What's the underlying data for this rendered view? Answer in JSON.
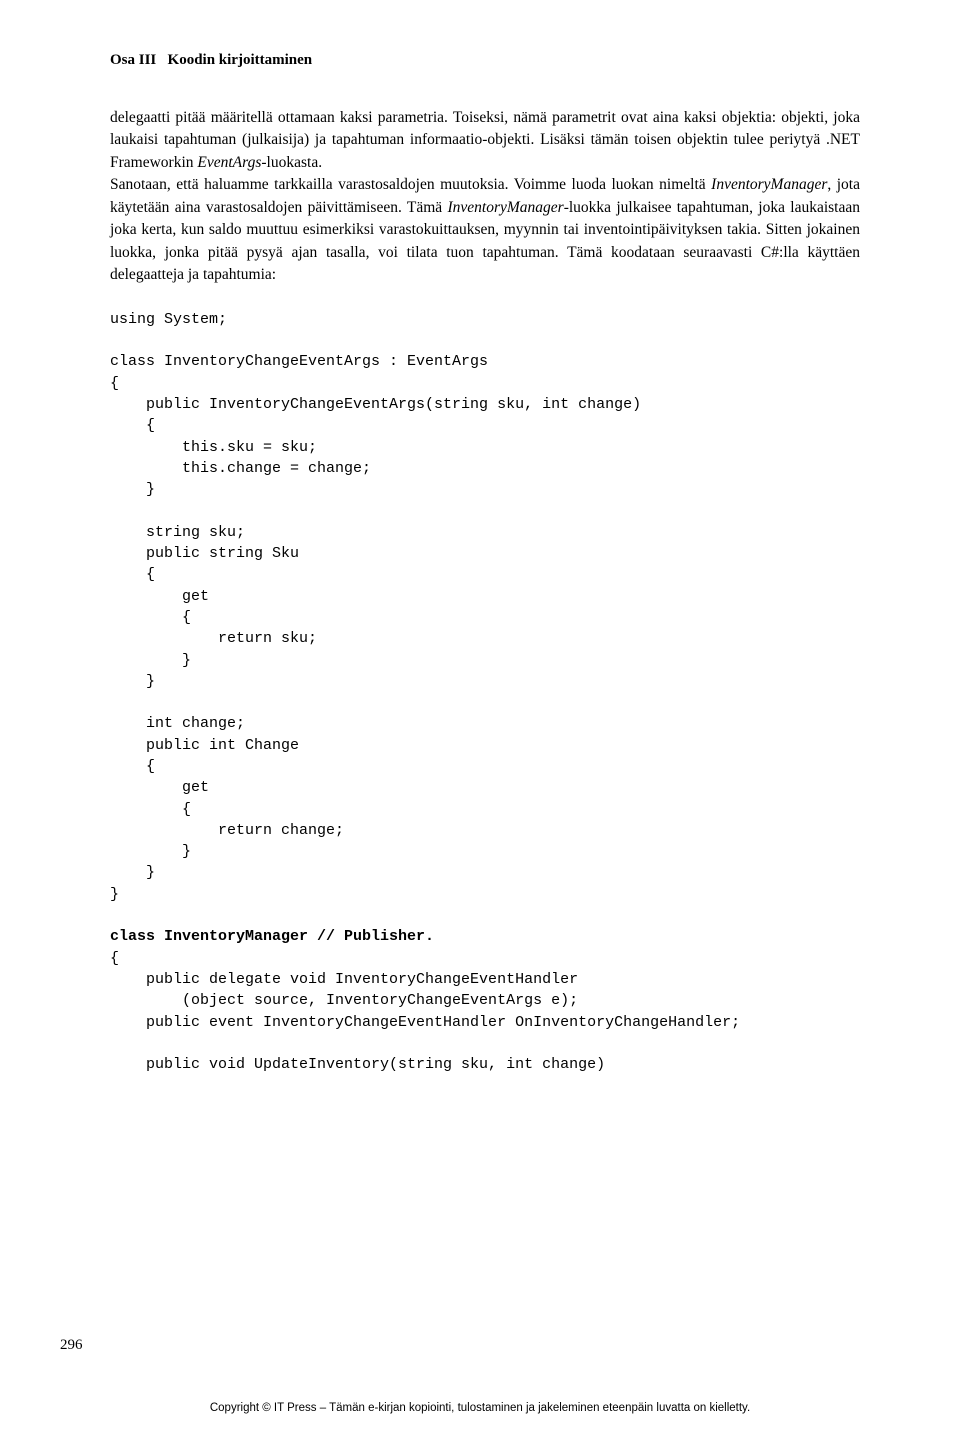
{
  "header": {
    "part": "Osa III",
    "title": "Koodin kirjoittaminen"
  },
  "paragraph1": "delegaatti pitää määritellä ottamaan kaksi parametria. Toiseksi, nämä parametrit ovat aina kaksi objektia: objekti, joka laukaisi tapahtuman (julkaisija) ja tapahtuman informaatio-objekti. Lisäksi tämän toisen objektin tulee periytyä .NET Frameworkin ",
  "paragraph1_italic1": "EventArgs",
  "paragraph1_cont": "-luokasta.",
  "paragraph2": "Sanotaan, että haluamme tarkkailla varastosaldojen muutoksia. Voimme luoda luokan nimeltä ",
  "paragraph2_italic1": "InventoryManager",
  "paragraph2_cont1": ", jota käytetään aina varastosaldojen päivittämiseen. Tämä ",
  "paragraph2_italic2": "InventoryManager",
  "paragraph2_cont2": "-luokka julkaisee tapahtuman, joka laukaistaan joka kerta, kun saldo muuttuu esimerkiksi varastokuittauksen, myynnin tai inventointipäivityksen takia. Sitten jokainen luokka, jonka pitää pysyä ajan tasalla, voi tilata tuon tapahtuman. Tämä koodataan seuraavasti C#:lla käyttäen delegaatteja ja tapahtumia:",
  "code": {
    "line1": "using System;",
    "line2": "class InventoryChangeEventArgs : EventArgs",
    "line3": "{",
    "line4": "    public InventoryChangeEventArgs(string sku, int change)",
    "line5": "    {",
    "line6": "        this.sku = sku;",
    "line7": "        this.change = change;",
    "line8": "    }",
    "line9": "    string sku;",
    "line10": "    public string Sku",
    "line11": "    {",
    "line12": "        get",
    "line13": "        {",
    "line14": "            return sku;",
    "line15": "        }",
    "line16": "    }",
    "line17": "    int change;",
    "line18": "    public int Change",
    "line19": "    {",
    "line20": "        get",
    "line21": "        {",
    "line22": "            return change;",
    "line23": "        }",
    "line24": "    }",
    "line25": "}",
    "line26": "class InventoryManager // Publisher.",
    "line27": "{",
    "line28": "    public delegate void InventoryChangeEventHandler",
    "line29": "        (object source, InventoryChangeEventArgs e);",
    "line30": "    public event InventoryChangeEventHandler OnInventoryChangeHandler;",
    "line31": "    public void UpdateInventory(string sku, int change)"
  },
  "pageNumber": "296",
  "footer": "Copyright © IT Press – Tämän e-kirjan kopiointi, tulostaminen ja jakeleminen eteenpäin luvatta on kielletty."
}
